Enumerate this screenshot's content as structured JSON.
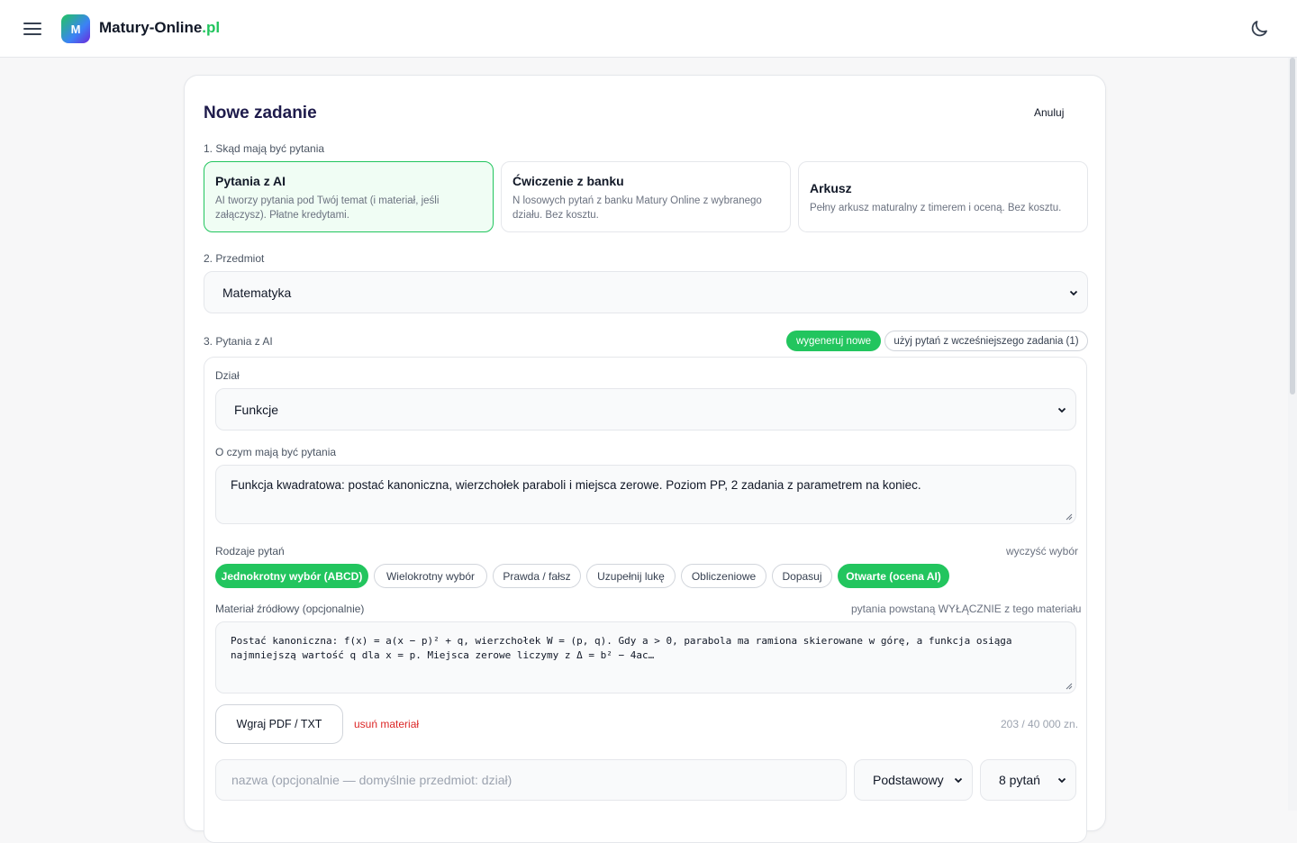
{
  "header": {
    "logo_letter": "M",
    "brand_name": "Matury-Online",
    "brand_tld": ".pl",
    "icons": [
      "hamburger-menu-icon",
      "moon-icon"
    ]
  },
  "form": {
    "title": "Nowe zadanie",
    "cancel_label": "Anuluj",
    "step1_label": "1. Skąd mają być pytania",
    "sources": [
      {
        "title": "Pytania z AI",
        "desc": "AI tworzy pytania pod Twój temat (i materiał, jeśli załączysz). Płatne kredytami.",
        "selected": true
      },
      {
        "title": "Ćwiczenie z banku",
        "desc": "N losowych pytań z banku Matury Online z wybranego działu. Bez kosztu.",
        "selected": false
      },
      {
        "title": "Arkusz",
        "desc": "Pełny arkusz maturalny z timerem i oceną. Bez kosztu.",
        "selected": false
      }
    ],
    "step2_label": "2. Przedmiot",
    "subject_value": "Matematyka",
    "step3_label": "3. Pytania z AI",
    "mode_generate_label": "wygeneruj nowe",
    "mode_reuse_label": "użyj pytań z wcześniejszego zadania (1)",
    "section_label": "Dział",
    "section_value": "Funkcje",
    "topic_label": "O czym mają być pytania",
    "topic_value": "Funkcja kwadratowa: postać kanoniczna, wierzchołek paraboli i miejsca zerowe. Poziom PP, 2 zadania z parametrem na koniec.",
    "types_label": "Rodzaje pytań",
    "types_clear_label": "wyczyść wybór",
    "question_types": [
      {
        "label": "Jednokrotny wybór (ABCD)",
        "selected": true
      },
      {
        "label": "Wielokrotny wybór",
        "selected": false
      },
      {
        "label": "Prawda / fałsz",
        "selected": false
      },
      {
        "label": "Uzupełnij lukę",
        "selected": false
      },
      {
        "label": "Obliczeniowe",
        "selected": false
      },
      {
        "label": "Dopasuj",
        "selected": false
      },
      {
        "label": "Otwarte (ocena AI)",
        "selected": true
      }
    ],
    "material_label": "Materiał źródłowy (opcjonalnie)",
    "material_note": "pytania powstaną WYŁĄCZNIE z tego materiału",
    "material_value": "Postać kanoniczna: f(x) = a(x − p)² + q, wierzchołek W = (p, q). Gdy a > 0, parabola ma ramiona skierowane w górę, a funkcja osiąga najmniejszą wartość q dla x = p. Miejsca zerowe liczymy z Δ = b² − 4ac…",
    "upload_label": "Wgraj PDF / TXT",
    "remove_material_label": "usuń materiał",
    "char_count": "203 / 40 000 zn.",
    "name_placeholder": "nazwa (opcjonalnie — domyślnie przedmiot: dział)",
    "level_value": "Podstawowy",
    "count_value": "8 pytań"
  },
  "colors": {
    "accent": "#22c55e",
    "danger": "#dc2626",
    "title": "#1e1b4b"
  }
}
